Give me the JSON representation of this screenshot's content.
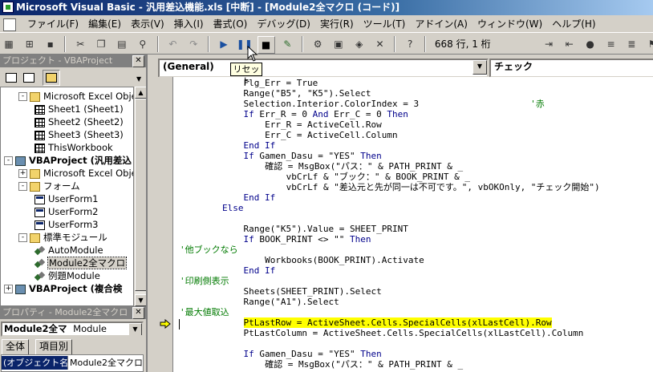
{
  "window": {
    "title": "Microsoft Visual Basic - 汎用差込機能.xls [中断] - [Module2全マクロ (コード)]"
  },
  "menu": [
    "ファイル(F)",
    "編集(E)",
    "表示(V)",
    "挿入(I)",
    "書式(O)",
    "デバッグ(D)",
    "実行(R)",
    "ツール(T)",
    "アドイン(A)",
    "ウィンドウ(W)",
    "ヘルプ(H)"
  ],
  "toolbar": {
    "position": "668 行, 1 桁",
    "tooltip": "リセット",
    "buttons": [
      "excel-view-icon",
      "insert-module-icon",
      "save-icon",
      "cut-icon",
      "copy-icon",
      "paste-icon",
      "find-icon",
      "undo-icon",
      "redo-icon",
      "run-icon",
      "break-icon",
      "reset-icon",
      "design-mode-icon",
      "project-explorer-icon",
      "properties-icon",
      "object-browser-icon",
      "toolbox-icon",
      "help-icon"
    ]
  },
  "project_panel": {
    "title": "プロジェクト - VBAProject",
    "tree": [
      {
        "expander": "-",
        "icon": "folder",
        "label": "Microsoft Excel Obje",
        "indent": 1
      },
      {
        "expander": "",
        "icon": "sheet",
        "label": "Sheet1 (Sheet1)",
        "indent": 2
      },
      {
        "expander": "",
        "icon": "sheet",
        "label": "Sheet2 (Sheet2)",
        "indent": 2
      },
      {
        "expander": "",
        "icon": "sheet",
        "label": "Sheet3 (Sheet3)",
        "indent": 2
      },
      {
        "expander": "",
        "icon": "sheet",
        "label": "ThisWorkbook",
        "indent": 2
      },
      {
        "expander": "-",
        "icon": "project",
        "label": "VBAProject (汎用差込",
        "indent": 0,
        "bold": true
      },
      {
        "expander": "+",
        "icon": "folder",
        "label": "Microsoft Excel Obje",
        "indent": 1
      },
      {
        "expander": "-",
        "icon": "folder",
        "label": "フォーム",
        "indent": 1
      },
      {
        "expander": "",
        "icon": "form",
        "label": "UserForm1",
        "indent": 2
      },
      {
        "expander": "",
        "icon": "form",
        "label": "UserForm2",
        "indent": 2
      },
      {
        "expander": "",
        "icon": "form",
        "label": "UserForm3",
        "indent": 2
      },
      {
        "expander": "-",
        "icon": "folder",
        "label": "標準モジュール",
        "indent": 1
      },
      {
        "expander": "",
        "icon": "module",
        "label": "AutoModule",
        "indent": 2
      },
      {
        "expander": "",
        "icon": "module",
        "label": "Module2全マクロ",
        "indent": 2,
        "selected": true
      },
      {
        "expander": "",
        "icon": "module",
        "label": "例題Module",
        "indent": 2
      },
      {
        "expander": "+",
        "icon": "project",
        "label": "VBAProject (複合検",
        "indent": 0,
        "bold": true
      }
    ]
  },
  "properties_panel": {
    "title": "プロパティ - Module2全マクロ",
    "object_name": "Module2全マ",
    "object_type": "Module",
    "tabs": [
      "全体",
      "項目別"
    ],
    "property_name": "(オブジェクト名)",
    "property_value": "Module2全マクロ"
  },
  "code_window": {
    "object_combo": "(General)",
    "proc_combo": "チェック",
    "lines": [
      {
        "indent": 12,
        "segs": [
          [
            "Flg_Err = True",
            "t"
          ]
        ]
      },
      {
        "indent": 12,
        "segs": [
          [
            "Range(\"B5\", \"K5\").Select",
            "t"
          ]
        ]
      },
      {
        "indent": 12,
        "segs": [
          [
            "Selection.Interior.ColorIndex = 3",
            "t"
          ],
          [
            "                     '赤",
            "c"
          ]
        ]
      },
      {
        "indent": 12,
        "segs": [
          [
            "If",
            "k"
          ],
          [
            " Err_R = 0 ",
            "t"
          ],
          [
            "And",
            "k"
          ],
          [
            " Err_C = 0 ",
            "t"
          ],
          [
            "Then",
            "k"
          ]
        ]
      },
      {
        "indent": 16,
        "segs": [
          [
            "Err_R = ActiveCell.Row",
            "t"
          ]
        ]
      },
      {
        "indent": 16,
        "segs": [
          [
            "Err_C = ActiveCell.Column",
            "t"
          ]
        ]
      },
      {
        "indent": 12,
        "segs": [
          [
            "End If",
            "k"
          ]
        ]
      },
      {
        "indent": 12,
        "segs": [
          [
            "If",
            "k"
          ],
          [
            " Gamen_Dasu = \"YES\" ",
            "t"
          ],
          [
            "Then",
            "k"
          ]
        ]
      },
      {
        "indent": 16,
        "segs": [
          [
            "確認 = MsgBox(\"パス：\" & PATH_PRINT & _",
            "t"
          ]
        ]
      },
      {
        "indent": 20,
        "segs": [
          [
            "vbCrLf & \"ブック：\" & BOOK_PRINT & _",
            "t"
          ]
        ]
      },
      {
        "indent": 20,
        "segs": [
          [
            "vbCrLf & \"差込元と先が同一は不可です。\", vbOKOnly, \"チェック開始\")",
            "t"
          ]
        ]
      },
      {
        "indent": 12,
        "segs": [
          [
            "End If",
            "k"
          ]
        ]
      },
      {
        "indent": 8,
        "segs": [
          [
            "Else",
            "k"
          ]
        ]
      },
      {
        "indent": 0,
        "segs": [
          [
            "",
            "t"
          ]
        ]
      },
      {
        "indent": 12,
        "segs": [
          [
            "Range(\"K5\").Value = SHEET_PRINT",
            "t"
          ]
        ]
      },
      {
        "indent": 12,
        "segs": [
          [
            "If",
            "k"
          ],
          [
            " BOOK_PRINT <> \"\" ",
            "t"
          ],
          [
            "Then",
            "k"
          ]
        ]
      },
      {
        "indent": 0,
        "segs": [
          [
            "'他ブックなら",
            "c"
          ]
        ]
      },
      {
        "indent": 16,
        "segs": [
          [
            "Workbooks(BOOK_PRINT).Activate",
            "t"
          ]
        ]
      },
      {
        "indent": 12,
        "segs": [
          [
            "End If",
            "k"
          ]
        ]
      },
      {
        "indent": 0,
        "segs": [
          [
            "'印刷側表示",
            "c"
          ]
        ]
      },
      {
        "indent": 12,
        "segs": [
          [
            "Sheets(SHEET_PRINT).Select",
            "t"
          ]
        ]
      },
      {
        "indent": 12,
        "segs": [
          [
            "Range(\"A1\").Select",
            "t"
          ]
        ]
      },
      {
        "indent": 0,
        "segs": [
          [
            "'最大値取込",
            "c"
          ]
        ]
      },
      {
        "indent": 12,
        "segs": [
          [
            "PtLastRow = ActiveSheet.Cells.SpecialCells(xlLastCell).Row",
            "h"
          ]
        ]
      },
      {
        "indent": 12,
        "segs": [
          [
            "PtLastColumn = ActiveSheet.Cells.SpecialCells(xlLastCell).Column",
            "t"
          ]
        ]
      },
      {
        "indent": 0,
        "segs": [
          [
            "",
            "t"
          ]
        ]
      },
      {
        "indent": 12,
        "segs": [
          [
            "If",
            "k"
          ],
          [
            " Gamen_Dasu = \"YES\" ",
            "t"
          ],
          [
            "Then",
            "k"
          ]
        ]
      },
      {
        "indent": 16,
        "segs": [
          [
            "確認 = MsgBox(\"パス：\" & PATH_PRINT & _",
            "t"
          ]
        ]
      }
    ]
  },
  "colors": {
    "keyword": "#00008b",
    "comment": "#007a00",
    "highlight": "#ffff00",
    "title_start": "#0a246a",
    "title_end": "#a6caf0"
  }
}
